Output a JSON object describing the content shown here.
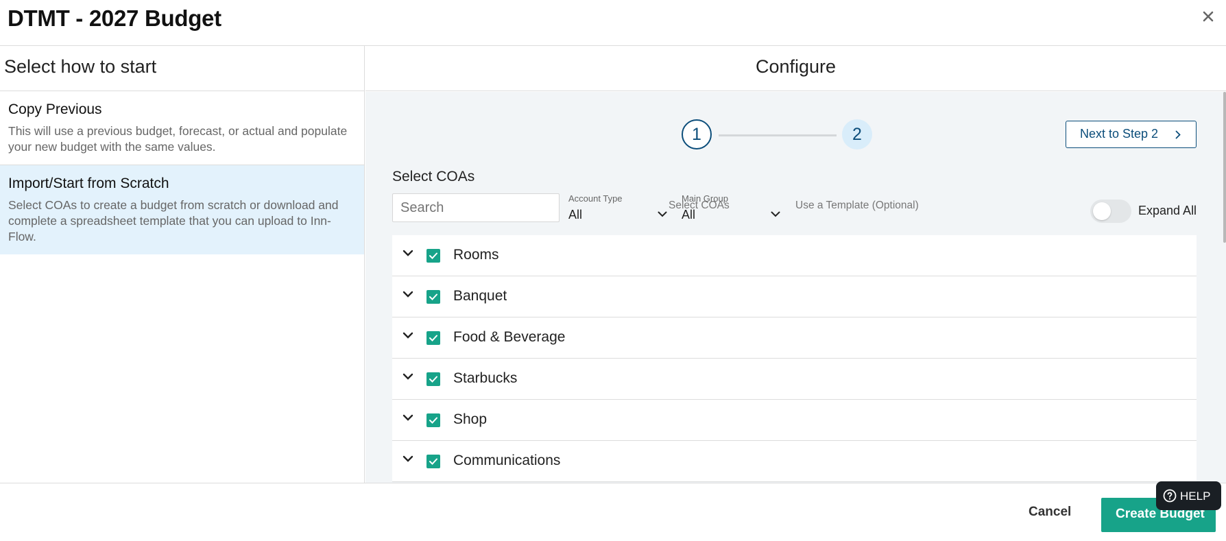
{
  "header": {
    "title": "DTMT - 2027 Budget"
  },
  "left": {
    "heading": "Select how to start",
    "options": [
      {
        "title": "Copy Previous",
        "description": "This will use a previous budget, forecast, or actual and populate your new budget with the same values."
      },
      {
        "title": "Import/Start from Scratch",
        "description": "Select COAs to create a budget from scratch or download and complete a spreadsheet template that you can upload to Inn-Flow."
      }
    ]
  },
  "right": {
    "heading": "Configure",
    "stepper": [
      {
        "number": "1",
        "label": "Select COAs"
      },
      {
        "number": "2",
        "label": "Use a Template (Optional)"
      }
    ],
    "next_button": "Next to Step 2",
    "section_title": "Select COAs",
    "search": {
      "placeholder": "Search",
      "value": ""
    },
    "filters": [
      {
        "label": "Account Type",
        "value": "All"
      },
      {
        "label": "Main Group",
        "value": "All"
      }
    ],
    "expand_all": {
      "label": "Expand All",
      "on": false
    },
    "coas": [
      "Rooms",
      "Banquet",
      "Food & Beverage",
      "Starbucks",
      "Shop",
      "Communications"
    ]
  },
  "footer": {
    "cancel": "Cancel",
    "create": "Create Budget",
    "help": "HELP"
  },
  "colors": {
    "accent_green": "#17a389",
    "brand_blue": "#0b4d7a",
    "selected_bg": "#e3f2fc",
    "config_bg": "#f2f5f7"
  },
  "icons": [
    "close-icon",
    "chevron-right-icon",
    "chevron-down-icon",
    "checkmark-icon",
    "help-icon"
  ]
}
